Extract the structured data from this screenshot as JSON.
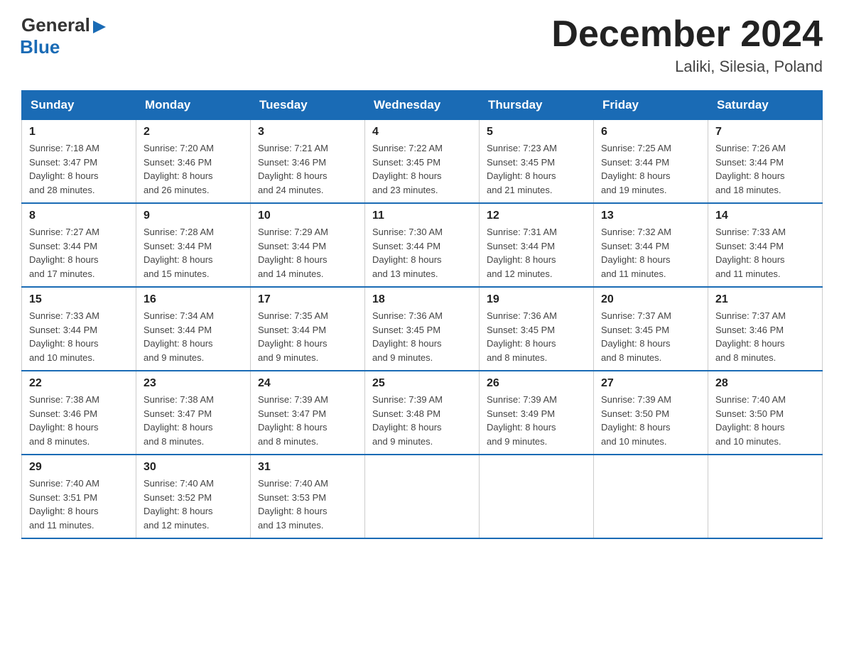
{
  "header": {
    "title": "December 2024",
    "location": "Laliki, Silesia, Poland",
    "logo_general": "General",
    "logo_blue": "Blue"
  },
  "days_of_week": [
    "Sunday",
    "Monday",
    "Tuesday",
    "Wednesday",
    "Thursday",
    "Friday",
    "Saturday"
  ],
  "weeks": [
    [
      {
        "day": "1",
        "sunrise": "7:18 AM",
        "sunset": "3:47 PM",
        "daylight": "8 hours and 28 minutes."
      },
      {
        "day": "2",
        "sunrise": "7:20 AM",
        "sunset": "3:46 PM",
        "daylight": "8 hours and 26 minutes."
      },
      {
        "day": "3",
        "sunrise": "7:21 AM",
        "sunset": "3:46 PM",
        "daylight": "8 hours and 24 minutes."
      },
      {
        "day": "4",
        "sunrise": "7:22 AM",
        "sunset": "3:45 PM",
        "daylight": "8 hours and 23 minutes."
      },
      {
        "day": "5",
        "sunrise": "7:23 AM",
        "sunset": "3:45 PM",
        "daylight": "8 hours and 21 minutes."
      },
      {
        "day": "6",
        "sunrise": "7:25 AM",
        "sunset": "3:44 PM",
        "daylight": "8 hours and 19 minutes."
      },
      {
        "day": "7",
        "sunrise": "7:26 AM",
        "sunset": "3:44 PM",
        "daylight": "8 hours and 18 minutes."
      }
    ],
    [
      {
        "day": "8",
        "sunrise": "7:27 AM",
        "sunset": "3:44 PM",
        "daylight": "8 hours and 17 minutes."
      },
      {
        "day": "9",
        "sunrise": "7:28 AM",
        "sunset": "3:44 PM",
        "daylight": "8 hours and 15 minutes."
      },
      {
        "day": "10",
        "sunrise": "7:29 AM",
        "sunset": "3:44 PM",
        "daylight": "8 hours and 14 minutes."
      },
      {
        "day": "11",
        "sunrise": "7:30 AM",
        "sunset": "3:44 PM",
        "daylight": "8 hours and 13 minutes."
      },
      {
        "day": "12",
        "sunrise": "7:31 AM",
        "sunset": "3:44 PM",
        "daylight": "8 hours and 12 minutes."
      },
      {
        "day": "13",
        "sunrise": "7:32 AM",
        "sunset": "3:44 PM",
        "daylight": "8 hours and 11 minutes."
      },
      {
        "day": "14",
        "sunrise": "7:33 AM",
        "sunset": "3:44 PM",
        "daylight": "8 hours and 11 minutes."
      }
    ],
    [
      {
        "day": "15",
        "sunrise": "7:33 AM",
        "sunset": "3:44 PM",
        "daylight": "8 hours and 10 minutes."
      },
      {
        "day": "16",
        "sunrise": "7:34 AM",
        "sunset": "3:44 PM",
        "daylight": "8 hours and 9 minutes."
      },
      {
        "day": "17",
        "sunrise": "7:35 AM",
        "sunset": "3:44 PM",
        "daylight": "8 hours and 9 minutes."
      },
      {
        "day": "18",
        "sunrise": "7:36 AM",
        "sunset": "3:45 PM",
        "daylight": "8 hours and 9 minutes."
      },
      {
        "day": "19",
        "sunrise": "7:36 AM",
        "sunset": "3:45 PM",
        "daylight": "8 hours and 8 minutes."
      },
      {
        "day": "20",
        "sunrise": "7:37 AM",
        "sunset": "3:45 PM",
        "daylight": "8 hours and 8 minutes."
      },
      {
        "day": "21",
        "sunrise": "7:37 AM",
        "sunset": "3:46 PM",
        "daylight": "8 hours and 8 minutes."
      }
    ],
    [
      {
        "day": "22",
        "sunrise": "7:38 AM",
        "sunset": "3:46 PM",
        "daylight": "8 hours and 8 minutes."
      },
      {
        "day": "23",
        "sunrise": "7:38 AM",
        "sunset": "3:47 PM",
        "daylight": "8 hours and 8 minutes."
      },
      {
        "day": "24",
        "sunrise": "7:39 AM",
        "sunset": "3:47 PM",
        "daylight": "8 hours and 8 minutes."
      },
      {
        "day": "25",
        "sunrise": "7:39 AM",
        "sunset": "3:48 PM",
        "daylight": "8 hours and 9 minutes."
      },
      {
        "day": "26",
        "sunrise": "7:39 AM",
        "sunset": "3:49 PM",
        "daylight": "8 hours and 9 minutes."
      },
      {
        "day": "27",
        "sunrise": "7:39 AM",
        "sunset": "3:50 PM",
        "daylight": "8 hours and 10 minutes."
      },
      {
        "day": "28",
        "sunrise": "7:40 AM",
        "sunset": "3:50 PM",
        "daylight": "8 hours and 10 minutes."
      }
    ],
    [
      {
        "day": "29",
        "sunrise": "7:40 AM",
        "sunset": "3:51 PM",
        "daylight": "8 hours and 11 minutes."
      },
      {
        "day": "30",
        "sunrise": "7:40 AM",
        "sunset": "3:52 PM",
        "daylight": "8 hours and 12 minutes."
      },
      {
        "day": "31",
        "sunrise": "7:40 AM",
        "sunset": "3:53 PM",
        "daylight": "8 hours and 13 minutes."
      },
      null,
      null,
      null,
      null
    ]
  ],
  "sunrise_label": "Sunrise:",
  "sunset_label": "Sunset:",
  "daylight_label": "Daylight:"
}
